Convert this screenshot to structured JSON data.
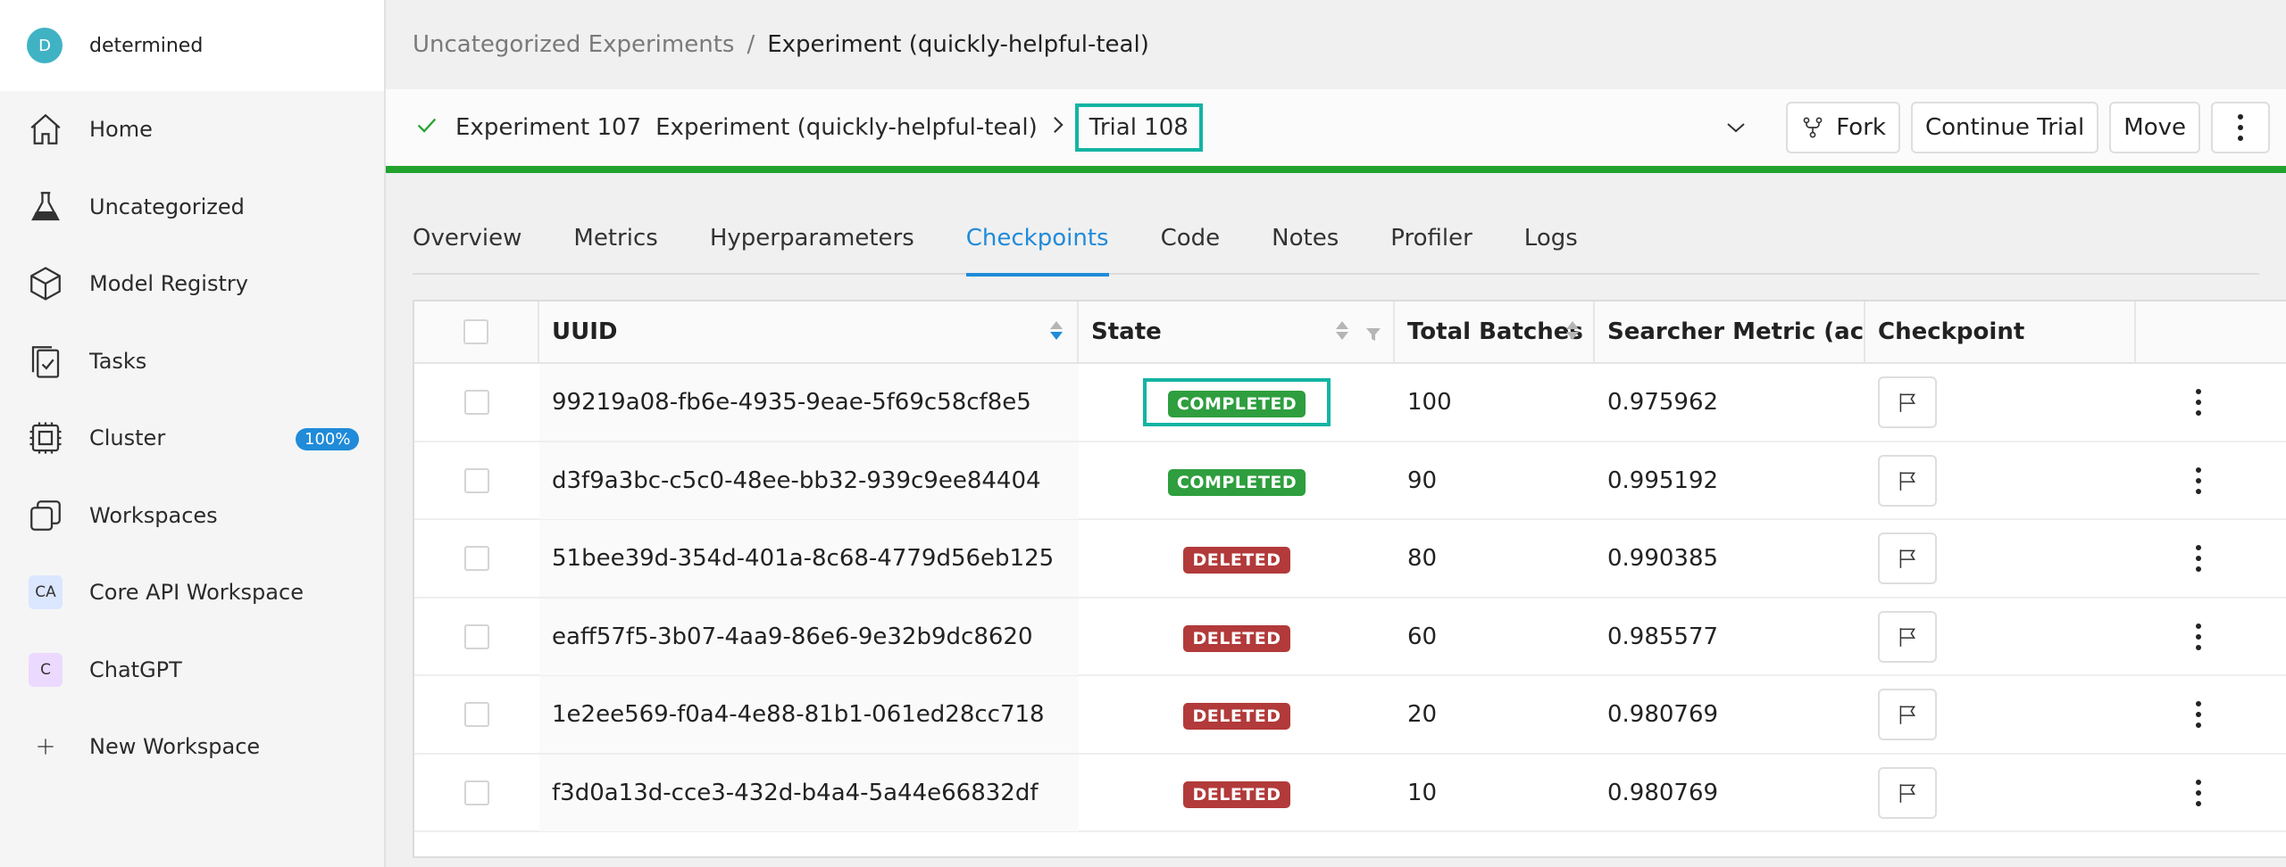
{
  "brand": {
    "initial": "D",
    "name": "determined"
  },
  "sidebar": {
    "items": [
      {
        "label": "Home",
        "icon": "home-icon"
      },
      {
        "label": "Uncategorized",
        "icon": "flask-icon"
      },
      {
        "label": "Model Registry",
        "icon": "cube-icon"
      },
      {
        "label": "Tasks",
        "icon": "tasks-icon"
      },
      {
        "label": "Cluster",
        "icon": "chip-icon",
        "badge": "100%"
      },
      {
        "label": "Workspaces",
        "icon": "workspaces-icon"
      },
      {
        "label": "Core API Workspace",
        "avatar": "CA",
        "avatar_color": "#dbe6ff"
      },
      {
        "label": "ChatGPT",
        "avatar": "C",
        "avatar_color": "#ecd9ff"
      },
      {
        "label": "New Workspace",
        "icon": "plus-icon"
      }
    ]
  },
  "breadcrumb": {
    "parent": "Uncategorized Experiments",
    "separator": "/",
    "current": "Experiment (quickly-helpful-teal)"
  },
  "header": {
    "experiment_id": "Experiment 107",
    "experiment_name": "Experiment (quickly-helpful-teal)",
    "trial": "Trial 108",
    "fork_label": "Fork",
    "continue_label": "Continue Trial",
    "move_label": "Move",
    "progress_color": "#22a32e",
    "progress": 1.0
  },
  "tabs": [
    "Overview",
    "Metrics",
    "Hyperparameters",
    "Checkpoints",
    "Code",
    "Notes",
    "Profiler",
    "Logs"
  ],
  "active_tab": "Checkpoints",
  "table": {
    "columns": [
      "UUID",
      "State",
      "Total Batches",
      "Searcher Metric (accura",
      "Checkpoint"
    ],
    "rows": [
      {
        "uuid": "99219a08-fb6e-4935-9eae-5f69c58cf8e5",
        "state": "COMPLETED",
        "batches": "100",
        "metric": "0.975962"
      },
      {
        "uuid": "d3f9a3bc-c5c0-48ee-bb32-939c9ee84404",
        "state": "COMPLETED",
        "batches": "90",
        "metric": "0.995192"
      },
      {
        "uuid": "51bee39d-354d-401a-8c68-4779d56eb125",
        "state": "DELETED",
        "batches": "80",
        "metric": "0.990385"
      },
      {
        "uuid": "eaff57f5-3b07-4aa9-86e6-9e32b9dc8620",
        "state": "DELETED",
        "batches": "60",
        "metric": "0.985577"
      },
      {
        "uuid": "1e2ee569-f0a4-4e88-81b1-061ed28cc718",
        "state": "DELETED",
        "batches": "20",
        "metric": "0.980769"
      },
      {
        "uuid": "f3d0a13d-cce3-432d-b4a4-5a44e66832df",
        "state": "DELETED",
        "batches": "10",
        "metric": "0.980769"
      }
    ],
    "state_colors": {
      "COMPLETED": "#2e9e3e",
      "DELETED": "#b23a3a"
    },
    "highlight_color": "#14b4a3"
  }
}
